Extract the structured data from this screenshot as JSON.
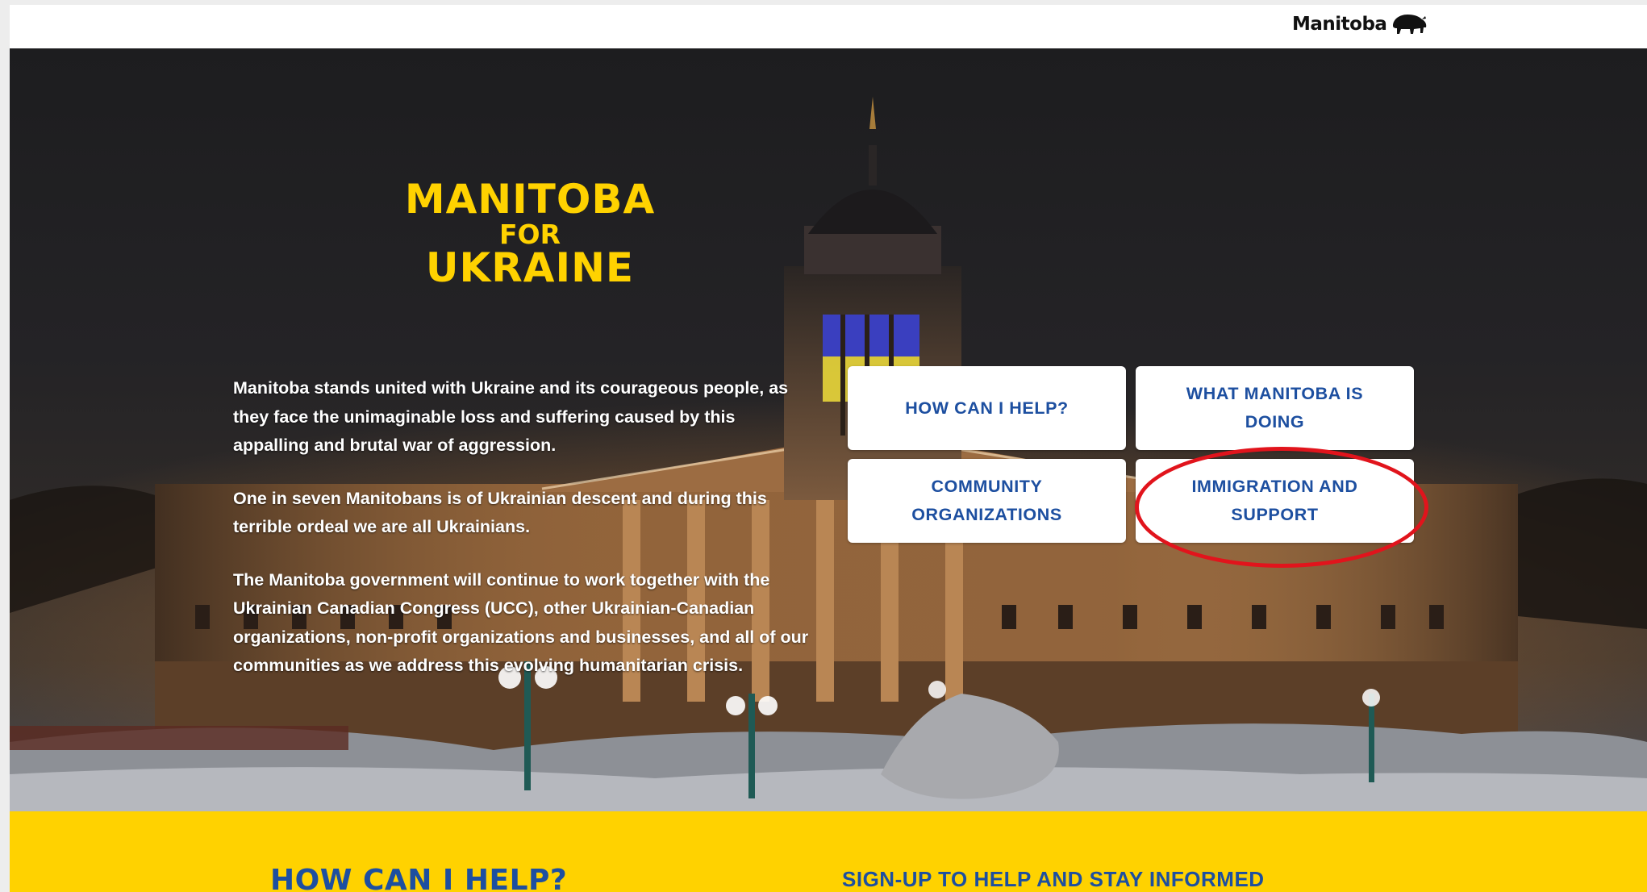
{
  "header": {
    "logo_text": "Manitoba",
    "logo_icon": "bison-icon"
  },
  "hero": {
    "title_line1": "MANITOBA",
    "title_line2": "FOR",
    "title_line3": "UKRAINE",
    "paragraphs": [
      "Manitoba stands united with Ukraine and its courageous people, as they face the unimaginable loss and suffering caused by this appalling and brutal war of aggression.",
      "One in seven Manitobans is of Ukrainian descent and during this terrible ordeal we are all Ukrainians.",
      "The Manitoba government will continue to work together with the Ukrainian Canadian Congress (UCC), other Ukrainian-Canadian organizations, non-profit organizations and businesses, and all of our communities as we address this evolving humanitarian crisis."
    ],
    "tiles": [
      {
        "label": "HOW CAN I HELP?"
      },
      {
        "label": "WHAT MANITOBA IS DOING"
      },
      {
        "label": "COMMUNITY ORGANIZATIONS"
      },
      {
        "label": "IMMIGRATION AND SUPPORT"
      }
    ]
  },
  "bottom": {
    "left_heading": "HOW CAN I HELP?",
    "right_heading": "SIGN-UP TO HELP AND STAY INFORMED"
  },
  "colors": {
    "accent_yellow": "#ffd200",
    "link_blue": "#1d4fa0",
    "annotation_red": "#e1141c",
    "flag_blue": "#3a3fbf",
    "flag_yellow": "#e8d63a"
  }
}
